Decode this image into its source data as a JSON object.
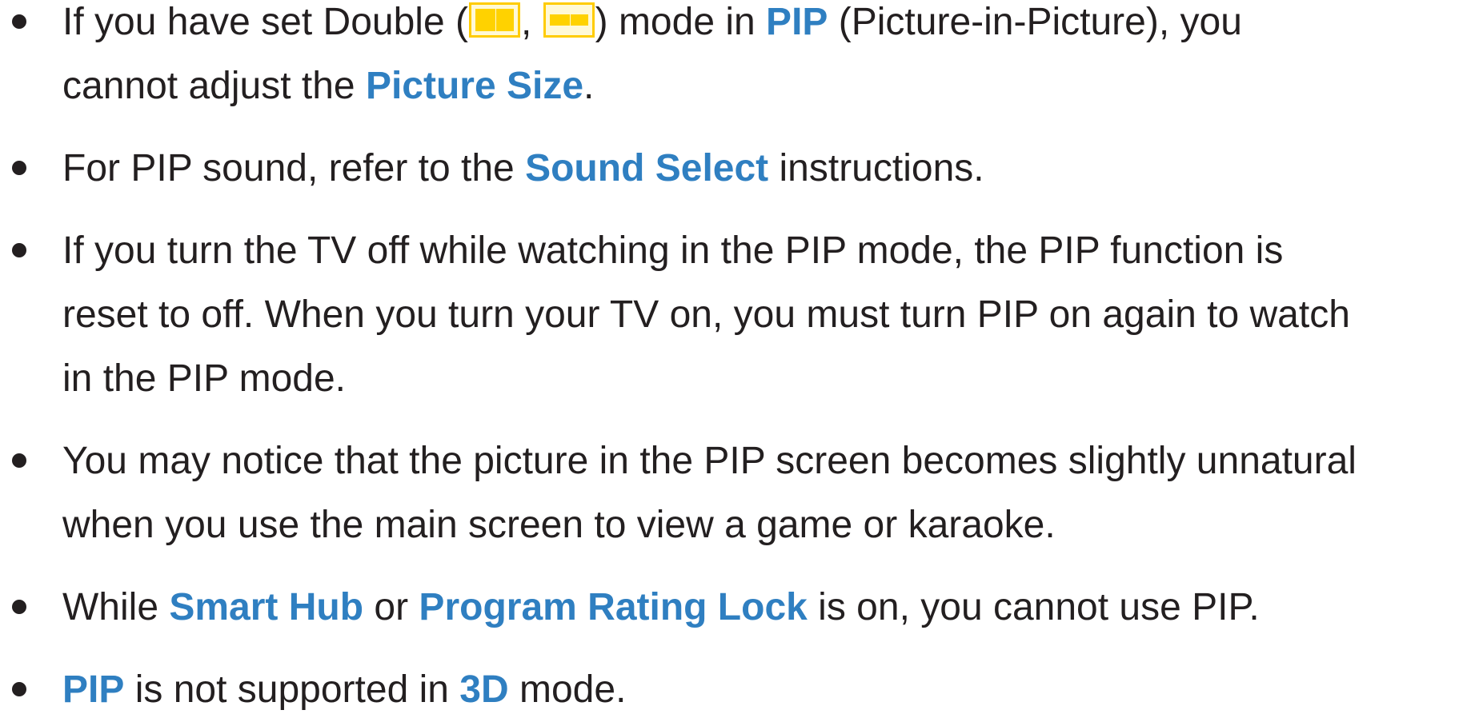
{
  "notes": {
    "item1": {
      "t1": "If you have set Double (",
      "t2": ", ",
      "t3": ") mode in ",
      "k1": "PIP",
      "t4": " (Picture-in-Picture), you",
      "t5": "cannot adjust the ",
      "k2": "Picture Size",
      "t6": ".",
      "icon_left": "double-screen-side-by-side-icon",
      "icon_right": "double-screen-picture-in-picture-icon"
    },
    "item2": {
      "t1": "For PIP sound, refer to the ",
      "k1": "Sound Select",
      "t2": " instructions."
    },
    "item3": {
      "line1": "If you turn the TV off while watching in the PIP mode, the PIP function is",
      "line2": "reset to off. When you turn your TV on, you must turn PIP on again to watch",
      "line3": "in the PIP mode."
    },
    "item4": {
      "line1": "You may notice that the picture in the PIP screen becomes slightly unnatural",
      "line2": "when you use the main screen to view a game or karaoke."
    },
    "item5": {
      "t1": "While ",
      "k1": "Smart Hub",
      "t2": " or ",
      "k2": "Program Rating Lock",
      "t3": " is on, you cannot use PIP."
    },
    "item6": {
      "k1": "PIP",
      "t1": " is not supported in ",
      "k2": "3D",
      "t2": " mode."
    }
  },
  "colors": {
    "text": "#231f20",
    "keyword": "#2f7fc1",
    "icon_fill": "#ffd200",
    "icon_border": "#ffcc00"
  }
}
